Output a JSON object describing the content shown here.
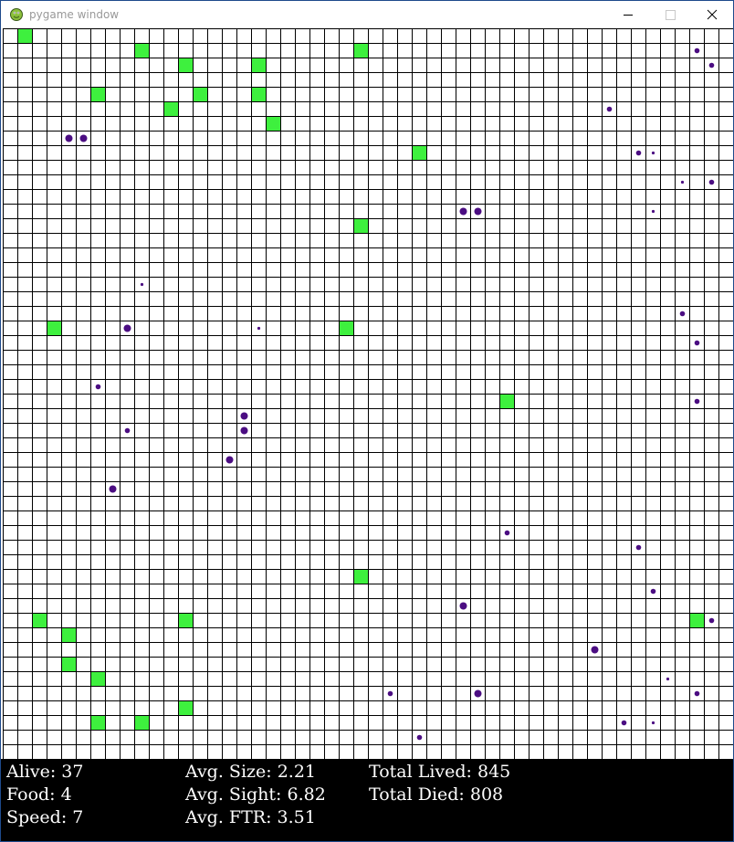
{
  "window": {
    "title": "pygame window",
    "icon": "snake-icon",
    "controls": [
      "minimize-icon",
      "maximize-icon",
      "close-icon"
    ]
  },
  "board": {
    "columns": 50,
    "rows": 50,
    "colors": {
      "background": "#ffffff",
      "grid_line": "#000000",
      "food": "#3ef03e",
      "creature": "#4b0d82",
      "panel": "#000000",
      "panel_text": "#ffffff"
    },
    "food_cells": [
      [
        1,
        0
      ],
      [
        9,
        1
      ],
      [
        24,
        1
      ],
      [
        12,
        2
      ],
      [
        17,
        2
      ],
      [
        6,
        4
      ],
      [
        13,
        4
      ],
      [
        17,
        4
      ],
      [
        11,
        5
      ],
      [
        18,
        6
      ],
      [
        28,
        8
      ],
      [
        24,
        13
      ],
      [
        3,
        20
      ],
      [
        23,
        20
      ],
      [
        34,
        25
      ],
      [
        24,
        37
      ],
      [
        2,
        40
      ],
      [
        12,
        40
      ],
      [
        47,
        40
      ],
      [
        4,
        41
      ],
      [
        4,
        43
      ],
      [
        6,
        44
      ],
      [
        12,
        46
      ],
      [
        6,
        47
      ],
      [
        9,
        47
      ]
    ],
    "creatures": [
      {
        "col": 47,
        "row": 1,
        "size": 2
      },
      {
        "col": 48,
        "row": 2,
        "size": 2
      },
      {
        "col": 41,
        "row": 5,
        "size": 2
      },
      {
        "col": 4,
        "row": 7,
        "size": 3
      },
      {
        "col": 5,
        "row": 7,
        "size": 3
      },
      {
        "col": 43,
        "row": 8,
        "size": 2
      },
      {
        "col": 44,
        "row": 8,
        "size": 1
      },
      {
        "col": 46,
        "row": 10,
        "size": 1
      },
      {
        "col": 48,
        "row": 10,
        "size": 2
      },
      {
        "col": 31,
        "row": 12,
        "size": 3
      },
      {
        "col": 32,
        "row": 12,
        "size": 3
      },
      {
        "col": 44,
        "row": 12,
        "size": 1
      },
      {
        "col": 9,
        "row": 17,
        "size": 1
      },
      {
        "col": 46,
        "row": 19,
        "size": 2
      },
      {
        "col": 8,
        "row": 20,
        "size": 3
      },
      {
        "col": 17,
        "row": 20,
        "size": 1
      },
      {
        "col": 47,
        "row": 21,
        "size": 2
      },
      {
        "col": 6,
        "row": 24,
        "size": 2
      },
      {
        "col": 47,
        "row": 25,
        "size": 2
      },
      {
        "col": 16,
        "row": 26,
        "size": 3
      },
      {
        "col": 8,
        "row": 27,
        "size": 2
      },
      {
        "col": 16,
        "row": 27,
        "size": 3
      },
      {
        "col": 15,
        "row": 29,
        "size": 3
      },
      {
        "col": 7,
        "row": 31,
        "size": 3
      },
      {
        "col": 34,
        "row": 34,
        "size": 2
      },
      {
        "col": 43,
        "row": 35,
        "size": 2
      },
      {
        "col": 44,
        "row": 38,
        "size": 2
      },
      {
        "col": 31,
        "row": 39,
        "size": 3
      },
      {
        "col": 48,
        "row": 40,
        "size": 2
      },
      {
        "col": 40,
        "row": 42,
        "size": 3
      },
      {
        "col": 45,
        "row": 44,
        "size": 1
      },
      {
        "col": 26,
        "row": 45,
        "size": 2
      },
      {
        "col": 32,
        "row": 45,
        "size": 3
      },
      {
        "col": 47,
        "row": 45,
        "size": 2
      },
      {
        "col": 42,
        "row": 47,
        "size": 2
      },
      {
        "col": 44,
        "row": 47,
        "size": 1
      },
      {
        "col": 28,
        "row": 48,
        "size": 2
      }
    ]
  },
  "stats": {
    "alive": "Alive: 37",
    "food": "Food: 4",
    "speed": "Speed: 7",
    "avg_size": "Avg. Size: 2.21",
    "avg_sight": "Avg. Sight: 6.82",
    "avg_ftr": "Avg. FTR: 3.51",
    "total_lived": "Total Lived: 845",
    "total_died": "Total Died: 808"
  }
}
